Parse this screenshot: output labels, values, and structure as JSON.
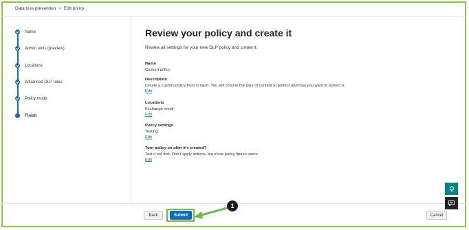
{
  "breadcrumb": [
    "Data loss prevention",
    "Edit policy"
  ],
  "breadcrumb_separator": ">",
  "steps": [
    {
      "label": "Name",
      "state": "done"
    },
    {
      "label": "Admin units (preview)",
      "state": "done"
    },
    {
      "label": "Locations",
      "state": "done"
    },
    {
      "label": "Advanced DLP rules",
      "state": "done"
    },
    {
      "label": "Policy mode",
      "state": "done"
    },
    {
      "label": "Finish",
      "state": "current"
    }
  ],
  "main": {
    "title": "Review your policy and create it",
    "intro": "Review all settings for your new DLP policy and create it.",
    "sections": [
      {
        "heading": "Name",
        "value": "Custom policy.",
        "edit": ""
      },
      {
        "heading": "Description",
        "value": "Create a custom policy from scratch. You will choose the type of content to protect and how you want to protect it.",
        "edit": "Edit"
      },
      {
        "heading": "Locations",
        "value": "Exchange email",
        "edit": "Edit"
      },
      {
        "heading": "Policy settings",
        "value": "Testing",
        "edit": "Edit"
      },
      {
        "heading": "Turn policy on after it's created?",
        "value": "Test it out first. Don't apply actions, but show policy tips to users.",
        "edit": "Edit"
      }
    ]
  },
  "footer": {
    "back_label": "Back",
    "submit_label": "Submit",
    "cancel_label": "Cancel"
  },
  "callout": {
    "number": "1"
  },
  "side_buttons": [
    {
      "icon": "lightbulb-icon"
    },
    {
      "icon": "chat-icon"
    }
  ],
  "colors": {
    "accent": "#0f6cbd",
    "highlight": "#6abf45",
    "teal": "#038387"
  }
}
